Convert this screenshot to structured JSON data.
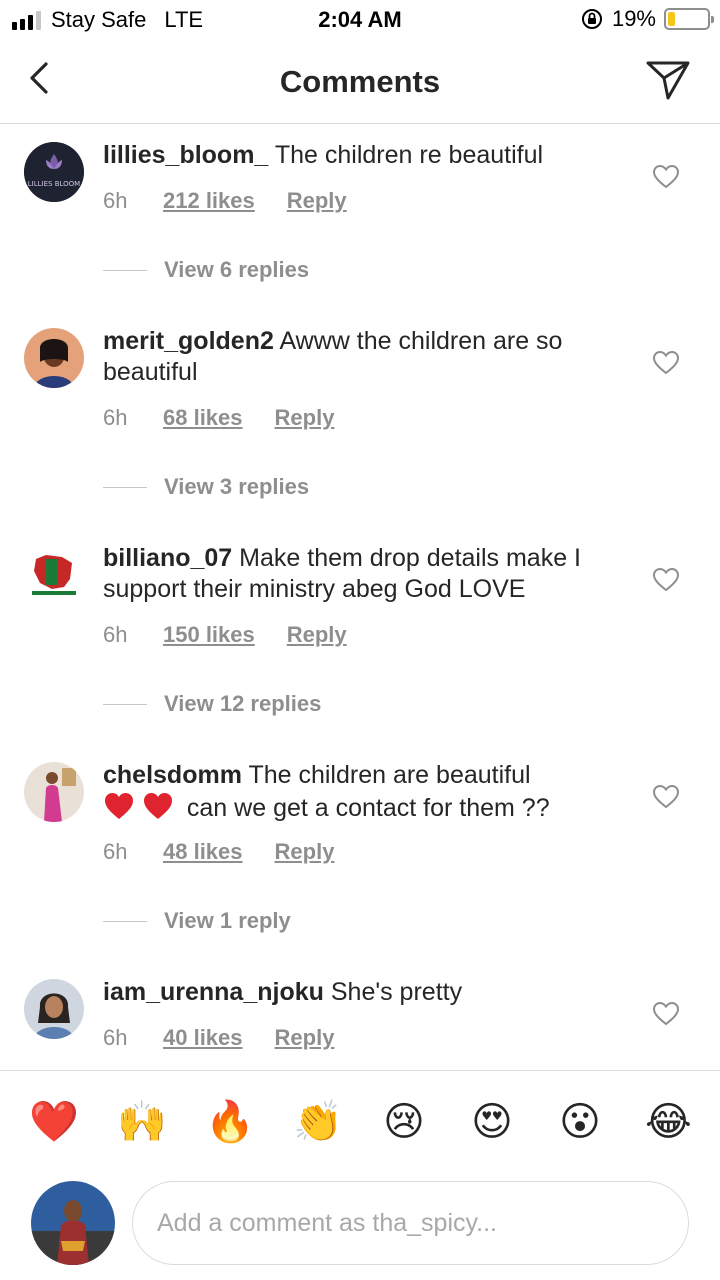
{
  "status_bar": {
    "carrier": "Stay Safe",
    "network": "LTE",
    "time": "2:04 AM",
    "battery": "19%",
    "battery_level": 0.19
  },
  "header": {
    "title": "Comments",
    "back_icon": "chevron-left-icon",
    "send_icon": "paper-plane-icon"
  },
  "comments": [
    {
      "username": "lillies_bloom_",
      "text": "The children re beautiful",
      "age": "6h",
      "likes": "212 likes",
      "reply": "Reply",
      "view_replies": "View 6 replies",
      "avatar_text": "LILLIES BLOOM"
    },
    {
      "username": "merit_golden2",
      "text": "Awww the children are so beautiful",
      "age": "6h",
      "likes": "68 likes",
      "reply": "Reply",
      "view_replies": "View 3 replies"
    },
    {
      "username": "billiano_07",
      "text": "Make them drop details make I support their ministry abeg God LOVE",
      "age": "6h",
      "likes": "150 likes",
      "reply": "Reply",
      "view_replies": "View 12 replies"
    },
    {
      "username": "chelsdomm",
      "text": "The children are beautiful",
      "text_after_emoji": "can we get a contact for them ??",
      "age": "6h",
      "likes": "48 likes",
      "reply": "Reply",
      "view_replies": "View 1 reply"
    },
    {
      "username": "iam_urenna_njoku",
      "text": "She's pretty",
      "age": "6h",
      "likes": "40 likes",
      "reply": "Reply"
    }
  ],
  "emoji_bar": [
    "❤️",
    "🙌",
    "🔥",
    "👏",
    "😢",
    "😍",
    "😮",
    "😂"
  ],
  "composer": {
    "placeholder": "Add a comment as tha_spicy..."
  },
  "colors": {
    "text": "#262626",
    "secondary": "#8e8e8e",
    "divider": "#dbdbdb",
    "battery": "#f5c518",
    "heart_red": "#e0242f"
  }
}
